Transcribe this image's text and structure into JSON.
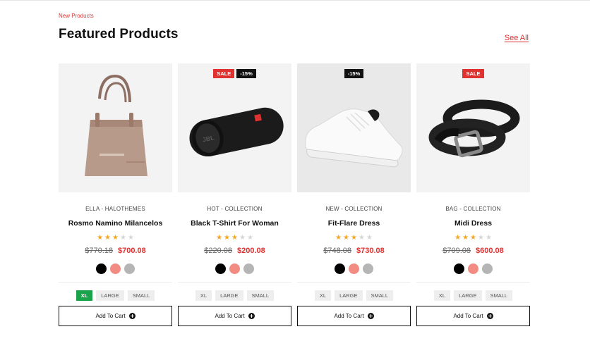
{
  "section": {
    "eyebrow": "New Products",
    "title": "Featured Products",
    "see_all": "See All"
  },
  "add_to_cart_label": "Add To Cart",
  "products": [
    {
      "image": "handbag-image",
      "badges": [],
      "vendor": "ELLA - HALOTHEMES",
      "name": "Rosmo Namino Milancelos",
      "rating": 3,
      "old_price": "$770.18",
      "price": "$700.08",
      "swatches": [
        "#000000",
        "#f28b82",
        "#b5b5b5"
      ],
      "sizes": [
        "XL",
        "LARGE",
        "SMALL"
      ],
      "active_size": "XL"
    },
    {
      "image": "speaker-image",
      "badges": [
        {
          "text": "SALE",
          "kind": "sale"
        },
        {
          "text": "-15%",
          "kind": "disc"
        }
      ],
      "vendor": "HOT - COLLECTION",
      "name": "Black T-Shirt For Woman",
      "rating": 3,
      "old_price": "$220.08",
      "price": "$200.08",
      "swatches": [
        "#000000",
        "#f28b82",
        "#b5b5b5"
      ],
      "sizes": [
        "XL",
        "LARGE",
        "SMALL"
      ],
      "active_size": ""
    },
    {
      "image": "sneaker-image",
      "badges": [
        {
          "text": "-15%",
          "kind": "disc"
        }
      ],
      "vendor": "NEW - COLLECTION",
      "name": "Fit-Flare Dress",
      "rating": 3,
      "old_price": "$748.08",
      "price": "$730.08",
      "swatches": [
        "#000000",
        "#f28b82",
        "#b5b5b5"
      ],
      "sizes": [
        "XL",
        "LARGE",
        "SMALL"
      ],
      "active_size": ""
    },
    {
      "image": "belt-image",
      "badges": [
        {
          "text": "SALE",
          "kind": "sale"
        }
      ],
      "vendor": "BAG - COLLECTION",
      "name": "Midi Dress",
      "rating": 3,
      "old_price": "$709.08",
      "price": "$600.08",
      "swatches": [
        "#000000",
        "#f28b82",
        "#b5b5b5"
      ],
      "sizes": [
        "XL",
        "LARGE",
        "SMALL"
      ],
      "active_size": ""
    }
  ],
  "colors": {
    "accent_red": "#e03131",
    "active_size_green": "#1aa34a",
    "star_gold": "#f5a623"
  }
}
